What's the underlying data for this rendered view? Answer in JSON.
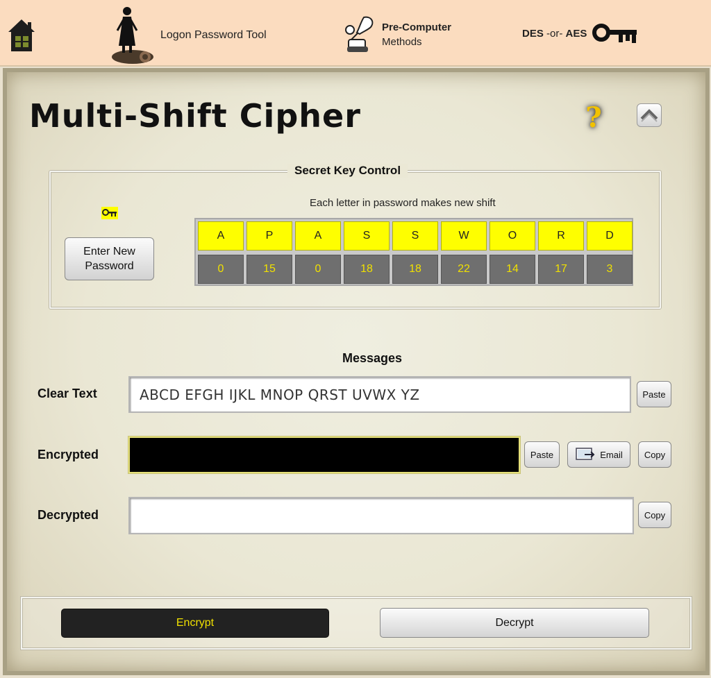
{
  "nav": {
    "home_icon": "house-icon",
    "logon_label": "Logon Password Tool",
    "logon_icon": "woman-on-log-icon",
    "precomp_label_line1": "Pre-Computer",
    "precomp_label_line2": "Methods",
    "precomp_icon": "quill-and-scroll-icon",
    "des_label_a": "DES",
    "des_label_b": "-or-",
    "des_label_c": "AES",
    "des_icon": "skeleton-key-icon"
  },
  "page": {
    "title": "Multi-Shift Cipher",
    "help_icon": "question-mark-icon",
    "collapse_icon": "chevron-up-icon"
  },
  "key_control": {
    "legend": "Secret Key Control",
    "key_icon": "small-key-icon",
    "enter_password_button": "Enter New\nPassword",
    "note": "Each letter in password makes new shift",
    "letters": [
      "A",
      "P",
      "A",
      "S",
      "S",
      "W",
      "O",
      "R",
      "D"
    ],
    "shifts": [
      "0",
      "15",
      "0",
      "18",
      "18",
      "22",
      "14",
      "17",
      "3"
    ]
  },
  "messages": {
    "heading": "Messages",
    "clear_label": "Clear Text",
    "clear_value": "ABCD EFGH IJKL MNOP QRST UVWX YZ",
    "encrypted_label": "Encrypted",
    "encrypted_value": "",
    "decrypted_label": "Decrypted",
    "decrypted_value": "",
    "paste_label": "Paste",
    "copy_label": "Copy",
    "email_label": "Email",
    "email_icon": "email-send-icon"
  },
  "actions": {
    "encrypt_label": "Encrypt",
    "decrypt_label": "Decrypt"
  },
  "colors": {
    "nav_bg": "#fbdcbf",
    "key_letter_bg": "#fefe00",
    "shift_bg": "#6f6f6f",
    "shift_text": "#f0e000",
    "encrypt_bg": "#222222"
  }
}
